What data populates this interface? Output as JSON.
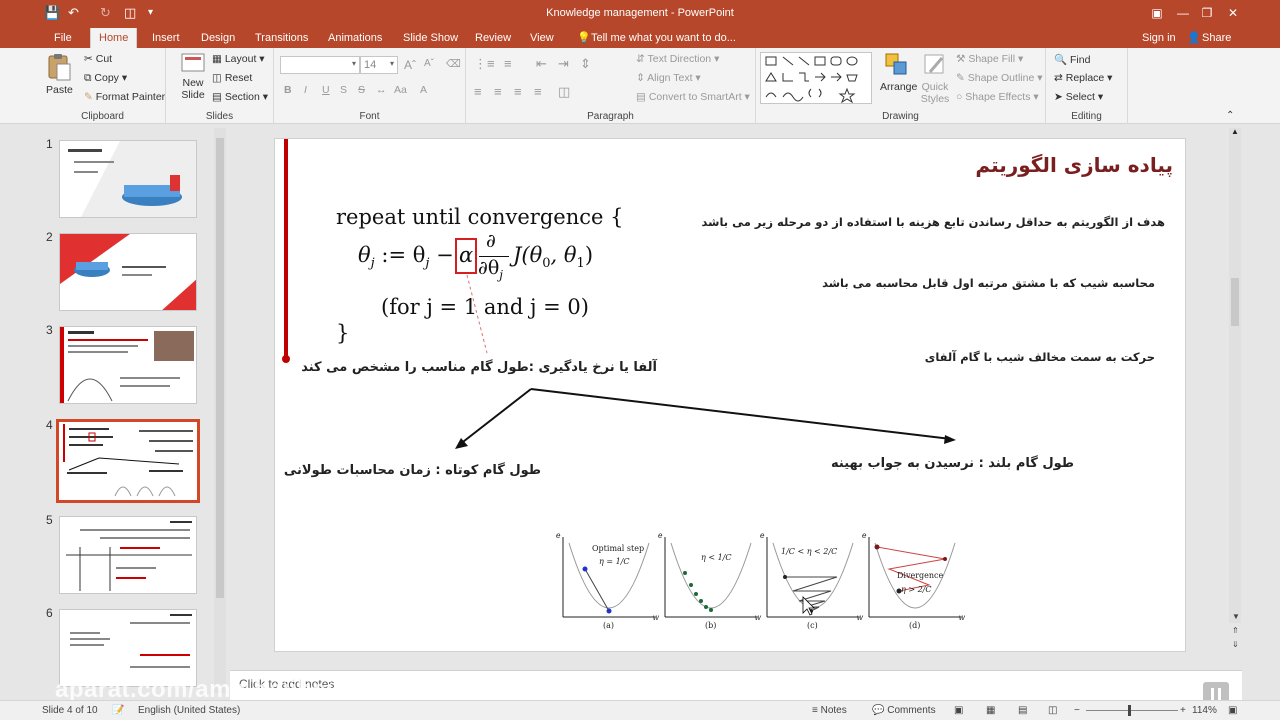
{
  "window": {
    "title": "Knowledge management - PowerPoint"
  },
  "tabs": [
    "File",
    "Home",
    "Insert",
    "Design",
    "Transitions",
    "Animations",
    "Slide Show",
    "Review",
    "View"
  ],
  "tell_me": "Tell me what you want to do...",
  "account": {
    "sign_in": "Sign in",
    "share": "Share"
  },
  "ribbon": {
    "clipboard": {
      "label": "Clipboard",
      "paste": "Paste",
      "cut": "Cut",
      "copy": "Copy",
      "format_painter": "Format Painter"
    },
    "slides": {
      "label": "Slides",
      "new_slide_1": "New",
      "new_slide_2": "Slide",
      "layout": "Layout",
      "reset": "Reset",
      "section": "Section"
    },
    "font": {
      "label": "Font",
      "size": "14",
      "bold": "B",
      "italic": "I",
      "underline": "U",
      "strike": "S"
    },
    "paragraph": {
      "label": "Paragraph",
      "text_direction": "Text Direction",
      "align_text": "Align Text",
      "smartart": "Convert to SmartArt"
    },
    "drawing": {
      "label": "Drawing",
      "arrange": "Arrange",
      "quick_1": "Quick",
      "quick_2": "Styles",
      "shape_fill": "Shape Fill",
      "shape_outline": "Shape Outline",
      "shape_effects": "Shape Effects"
    },
    "editing": {
      "label": "Editing",
      "find": "Find",
      "replace": "Replace",
      "select": "Select"
    }
  },
  "thumbnails": [
    {
      "num": "1"
    },
    {
      "num": "2"
    },
    {
      "num": "3"
    },
    {
      "num": "4"
    },
    {
      "num": "5"
    },
    {
      "num": "6"
    }
  ],
  "slide": {
    "title": "پیاده سازی الگوریتم",
    "math": {
      "repeat": "repeat until convergence {",
      "update_lhs": "θ",
      "update_sub": "j",
      "assign": " := θ",
      "minus": " −",
      "alpha": "α",
      "partial_top": "∂",
      "partial_bottom": "∂θ",
      "partial_sub": "j",
      "func": "J(θ",
      "func_sub0": "0",
      "func_mid": ", θ",
      "func_sub1": "1",
      "func_end": ")",
      "for_clause": "(for j = 1 and j = 0)",
      "close_brace": "}"
    },
    "bullet1": "هدف از الگوریتم به حداقل رساندن تابع هزینه با استفاده از دو مرحله زیر می باشد",
    "bullet2": "محاسبه شیب که با مشتق مرتبه اول قابل محاسبه می باشد",
    "bullet3": "حرکت به سمت مخالف شیب با گام آلفای",
    "alpha_note": "آلفا یا نرخ یادگیری :طول گام مناسب را مشخص می کند",
    "short_step": "طول گام کوتاه : زمان محاسبات طولانی",
    "long_step": "طول گام بلند : نرسیدن به جواب بهینه",
    "plots": [
      {
        "caption": "(a)",
        "label": "Optimal step",
        "eta": "η = 1/C"
      },
      {
        "caption": "(b)",
        "label": "",
        "eta": "η < 1/C"
      },
      {
        "caption": "(c)",
        "label": "",
        "eta": "1/C < η < 2/C"
      },
      {
        "caption": "(d)",
        "label": "Divergence",
        "eta": "η > 2/C"
      }
    ],
    "axis_x": "w",
    "axis_y": "e"
  },
  "notes": {
    "placeholder": "Click to add notes"
  },
  "watermark": "aparat.com/amir.hajibeigi",
  "status": {
    "slide_of": "Slide 4 of 10",
    "language": "English (United States)",
    "notes": "Notes",
    "comments": "Comments",
    "zoom": "114%"
  },
  "colors": {
    "accent": "#b7472a",
    "selection": "#d24726",
    "slide_title": "#7a1f1f"
  }
}
